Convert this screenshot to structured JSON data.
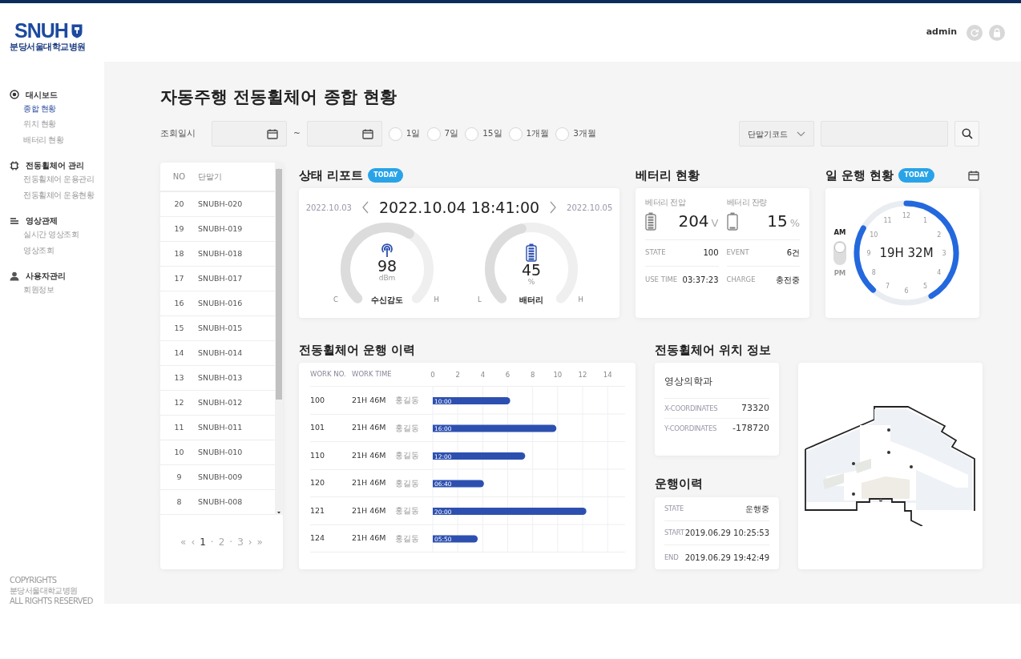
{
  "header": {
    "user": "admin"
  },
  "logo": {
    "mark": "SNUH",
    "subtitle": "분당서울대학교병원"
  },
  "sidebar": {
    "groups": [
      {
        "kind": "target",
        "title": "대시보드",
        "items": [
          {
            "label": "종합 현황",
            "selected": true
          },
          {
            "label": "위치 현황",
            "selected": false
          },
          {
            "label": "배터리 현황",
            "selected": false
          }
        ]
      },
      {
        "kind": "chip",
        "title": "전동휠체어 관리",
        "items": [
          {
            "label": "전동휠체어 운용관리",
            "selected": false
          },
          {
            "label": "전동휠체어 운용현황",
            "selected": false
          }
        ]
      },
      {
        "kind": "lines",
        "title": "영상관제",
        "items": [
          {
            "label": "실시간 영상조회",
            "selected": false
          },
          {
            "label": "영상조회",
            "selected": false
          }
        ]
      },
      {
        "kind": "user",
        "title": "사용자관리",
        "items": [
          {
            "label": "회원정보",
            "selected": false
          }
        ]
      }
    ],
    "copyright": [
      "COPYRIGHTS",
      "분당서울대학교병원",
      "ALL RIGHTS RESERVED"
    ]
  },
  "page_title": "자동주행 전동휠체어 종합 현황",
  "filter": {
    "label": "조회일시",
    "separator": "~",
    "ranges": [
      {
        "label": "1일",
        "selected": false
      },
      {
        "label": "7일",
        "selected": false
      },
      {
        "label": "15일",
        "selected": false
      },
      {
        "label": "1개월",
        "selected": false
      },
      {
        "label": "3개월",
        "selected": false
      }
    ],
    "code_select": "단말기코드"
  },
  "device_list": {
    "columns": [
      "NO",
      "단말기"
    ],
    "rows": [
      {
        "no": "20",
        "device": "SNUBH-020"
      },
      {
        "no": "19",
        "device": "SNUBH-019"
      },
      {
        "no": "18",
        "device": "SNUBH-018"
      },
      {
        "no": "17",
        "device": "SNUBH-017"
      },
      {
        "no": "16",
        "device": "SNUBH-016"
      },
      {
        "no": "15",
        "device": "SNUBH-015"
      },
      {
        "no": "14",
        "device": "SNUBH-014"
      },
      {
        "no": "13",
        "device": "SNUBH-013"
      },
      {
        "no": "12",
        "device": "SNUBH-012"
      },
      {
        "no": "11",
        "device": "SNUBH-011"
      },
      {
        "no": "10",
        "device": "SNUBH-010"
      },
      {
        "no": "9",
        "device": "SNUBH-009"
      },
      {
        "no": "8",
        "device": "SNUBH-008"
      }
    ],
    "pagination": [
      {
        "kind": "nav",
        "text": "«"
      },
      {
        "kind": "nav",
        "text": "‹"
      },
      {
        "kind": "page",
        "text": "1",
        "selected": true
      },
      {
        "kind": "sep",
        "text": "·"
      },
      {
        "kind": "page",
        "text": "2",
        "selected": false
      },
      {
        "kind": "sep",
        "text": "·"
      },
      {
        "kind": "page",
        "text": "3",
        "selected": false
      },
      {
        "kind": "nav",
        "text": "›"
      },
      {
        "kind": "nav",
        "text": "»"
      }
    ]
  },
  "status_report": {
    "title": "상태 리포트",
    "badge": "TODAY",
    "prev_date": "2022.10.03",
    "current": "2022.10.04 18:41:00",
    "next_date": "2022.10.05",
    "gauges": [
      {
        "kind": "signal",
        "value": "98",
        "unit": "dBm",
        "label": "수신감도",
        "min_label": "C",
        "max_label": "H"
      },
      {
        "kind": "battery",
        "value": "45",
        "unit": "%",
        "label": "배터리",
        "min_label": "L",
        "max_label": "H"
      }
    ]
  },
  "battery": {
    "title": "베터리 현황",
    "readings": [
      {
        "kind": "voltage",
        "label": "베터리 전압",
        "value": "204",
        "unit": "V"
      },
      {
        "kind": "remaining",
        "label": "베터리 잔량",
        "value": "15",
        "unit": "%"
      }
    ],
    "stats": [
      {
        "label": "STATE",
        "value": "100"
      },
      {
        "label": "EVENT",
        "value": "6건"
      },
      {
        "label": "USE TIME",
        "value": "03:37:23"
      },
      {
        "label": "CHARGE",
        "value": "충전중"
      }
    ]
  },
  "daily": {
    "title": "일 운행 현황",
    "badge": "TODAY",
    "am": "AM",
    "pm": "PM",
    "pm_on": false,
    "clock_numbers": [
      "12",
      "1",
      "2",
      "3",
      "4",
      "5",
      "6",
      "7",
      "8",
      "9",
      "10",
      "11"
    ],
    "time": "19H 32M"
  },
  "history": {
    "title": "전동휠체어 운행 이력",
    "columns": [
      "WORK NO.",
      "WORK TIME"
    ],
    "rows": [
      {
        "work_no": "100",
        "work_time": "21H 46M",
        "name": "홍길동",
        "bar_label": "10:00"
      },
      {
        "work_no": "101",
        "work_time": "21H 46M",
        "name": "홍길동",
        "bar_label": "16:00"
      },
      {
        "work_no": "110",
        "work_time": "21H 46M",
        "name": "홍길동",
        "bar_label": "12:00"
      },
      {
        "work_no": "120",
        "work_time": "21H 46M",
        "name": "홍길동",
        "bar_label": "06:40"
      },
      {
        "work_no": "121",
        "work_time": "21H 46M",
        "name": "홍길동",
        "bar_label": "20:00"
      },
      {
        "work_no": "124",
        "work_time": "21H 46M",
        "name": "홍길동",
        "bar_label": "05:50"
      }
    ],
    "chart_data": {
      "type": "bar",
      "orientation": "horizontal",
      "values": [
        6.2,
        9.9,
        7.4,
        4.1,
        12.3,
        3.6
      ],
      "xlim": [
        0,
        15.4
      ],
      "xticks": [
        0,
        2,
        4,
        6,
        8,
        10,
        12,
        14
      ],
      "grid": true
    }
  },
  "location": {
    "title": "전동휠체어 위치 정보",
    "place": "영상의학과",
    "coords": [
      {
        "label": "X-COORDINATES",
        "value": "73320"
      },
      {
        "label": "Y-COORDINATES",
        "value": "-178720"
      }
    ]
  },
  "run_log": {
    "title": "운행이력",
    "rows": [
      {
        "label": "STATE",
        "value": "운행중"
      },
      {
        "label": "START",
        "value": "2019.06.29 10:25:53"
      },
      {
        "label": "END",
        "value": "2019.06.29 19:42:49"
      }
    ]
  }
}
